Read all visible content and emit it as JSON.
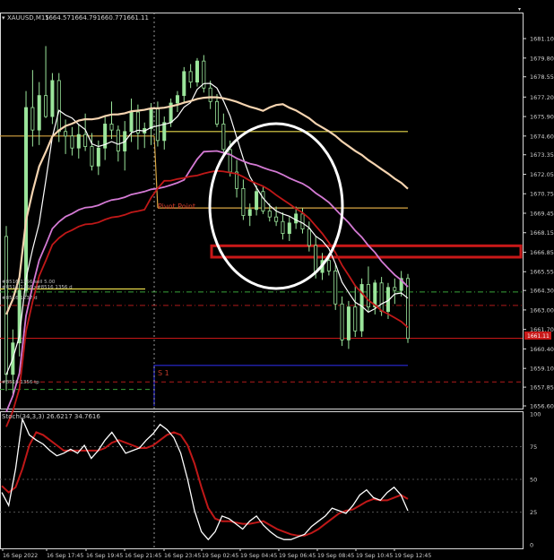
{
  "window": {
    "symbol_label": "XAUUSD,M15",
    "ohlc": [
      "1664.57",
      "1664.79",
      "1660.77",
      "1661.11"
    ]
  },
  "colors": {
    "background": "#000000",
    "bull_candle": "#9be59b",
    "bear_candle": "#9be59b",
    "white_line": "#ffffff",
    "peach_ma": "#f5d4b0",
    "violet_ma": "#d47ad4",
    "red_ma": "#c01818",
    "pivot_line": "#d9a642",
    "yellow_line": "#e6d84a",
    "red_zone": "#c81818",
    "ellipse": "#ffffff",
    "s1_line": "#2a2ad8",
    "stoch_main": "#ffffff",
    "stoch_signal": "#c01818"
  },
  "annotations": {
    "pivot_label": "Pivot Point",
    "s1_label": "S 1",
    "order_labels": [
      "#8516 1356 sell 5.00",
      "#8516 1356 s#8516 1356 d",
      "#8516 1237 d",
      "#8516 1356 tp"
    ],
    "current_price": "1661.11"
  },
  "stoch": {
    "label": "Stoch(34,3,3) 26.6217 34.7616",
    "levels": [
      "100",
      "75",
      "50",
      "25",
      "0"
    ]
  },
  "chart_data": [
    {
      "type": "candlestick",
      "title": "XAUUSD,M15",
      "ylim": [
        1656.6,
        1682.0
      ],
      "yticks": [
        "1681.10",
        "1679.80",
        "1678.55",
        "1677.20",
        "1675.90",
        "1674.60",
        "1673.35",
        "1672.05",
        "1670.75",
        "1669.45",
        "1668.15",
        "1666.85",
        "1665.55",
        "1664.30",
        "1663.00",
        "1661.70",
        "1660.40",
        "1659.10",
        "1657.85",
        "1656.60"
      ],
      "xticks": [
        "16 Sep 2022",
        "16 Sep 17:45",
        "16 Sep 19:45",
        "16 Sep 21:45",
        "16 Sep 23:45",
        "19 Sep 02:45",
        "19 Sep 04:45",
        "19 Sep 06:45",
        "19 Sep 08:45",
        "19 Sep 10:45",
        "19 Sep 12:45"
      ],
      "candles": [
        {
          "o": 1667.9,
          "h": 1668.6,
          "l": 1657.6,
          "c": 1658.7
        },
        {
          "o": 1658.7,
          "h": 1661.7,
          "l": 1657.4,
          "c": 1660.8
        },
        {
          "o": 1660.8,
          "h": 1665.2,
          "l": 1659.9,
          "c": 1664.3
        },
        {
          "o": 1664.3,
          "h": 1677.6,
          "l": 1663.9,
          "c": 1676.5
        },
        {
          "o": 1676.5,
          "h": 1679.0,
          "l": 1673.9,
          "c": 1675.0
        },
        {
          "o": 1675.0,
          "h": 1678.2,
          "l": 1674.0,
          "c": 1677.3
        },
        {
          "o": 1677.3,
          "h": 1680.6,
          "l": 1675.8,
          "c": 1675.9
        },
        {
          "o": 1675.9,
          "h": 1678.8,
          "l": 1675.4,
          "c": 1678.3
        },
        {
          "o": 1678.3,
          "h": 1678.8,
          "l": 1674.2,
          "c": 1674.9
        },
        {
          "o": 1674.9,
          "h": 1675.7,
          "l": 1673.4,
          "c": 1674.6
        },
        {
          "o": 1674.6,
          "h": 1675.2,
          "l": 1673.3,
          "c": 1673.8
        },
        {
          "o": 1673.8,
          "h": 1675.4,
          "l": 1673.1,
          "c": 1674.7
        },
        {
          "o": 1674.7,
          "h": 1676.1,
          "l": 1673.6,
          "c": 1673.9
        },
        {
          "o": 1673.9,
          "h": 1674.8,
          "l": 1672.3,
          "c": 1672.6
        },
        {
          "o": 1672.6,
          "h": 1674.3,
          "l": 1672.0,
          "c": 1673.8
        },
        {
          "o": 1673.8,
          "h": 1676.0,
          "l": 1673.0,
          "c": 1675.4
        },
        {
          "o": 1675.4,
          "h": 1676.9,
          "l": 1674.4,
          "c": 1675.0
        },
        {
          "o": 1675.0,
          "h": 1675.3,
          "l": 1672.9,
          "c": 1673.6
        },
        {
          "o": 1673.6,
          "h": 1675.6,
          "l": 1672.3,
          "c": 1674.9
        },
        {
          "o": 1674.9,
          "h": 1677.1,
          "l": 1674.2,
          "c": 1676.2
        },
        {
          "o": 1676.2,
          "h": 1676.7,
          "l": 1673.7,
          "c": 1674.8
        },
        {
          "o": 1674.8,
          "h": 1675.5,
          "l": 1673.8,
          "c": 1675.1
        },
        {
          "o": 1675.1,
          "h": 1676.8,
          "l": 1674.0,
          "c": 1676.4
        },
        {
          "o": 1676.4,
          "h": 1676.9,
          "l": 1673.9,
          "c": 1674.3
        },
        {
          "o": 1674.3,
          "h": 1675.9,
          "l": 1673.7,
          "c": 1675.5
        },
        {
          "o": 1675.5,
          "h": 1677.1,
          "l": 1675.2,
          "c": 1676.8
        },
        {
          "o": 1676.8,
          "h": 1677.6,
          "l": 1676.2,
          "c": 1677.3
        },
        {
          "o": 1677.3,
          "h": 1679.2,
          "l": 1676.8,
          "c": 1678.9
        },
        {
          "o": 1678.9,
          "h": 1679.4,
          "l": 1677.8,
          "c": 1678.2
        },
        {
          "o": 1678.2,
          "h": 1679.8,
          "l": 1677.9,
          "c": 1679.6
        },
        {
          "o": 1679.6,
          "h": 1680.0,
          "l": 1677.5,
          "c": 1677.8
        },
        {
          "o": 1677.8,
          "h": 1678.3,
          "l": 1676.4,
          "c": 1676.9
        },
        {
          "o": 1676.9,
          "h": 1677.4,
          "l": 1675.2,
          "c": 1675.4
        },
        {
          "o": 1675.4,
          "h": 1676.1,
          "l": 1673.4,
          "c": 1673.7
        },
        {
          "o": 1673.7,
          "h": 1674.3,
          "l": 1671.9,
          "c": 1672.2
        },
        {
          "o": 1672.2,
          "h": 1673.0,
          "l": 1670.5,
          "c": 1671.1
        },
        {
          "o": 1671.1,
          "h": 1671.7,
          "l": 1669.0,
          "c": 1669.3
        },
        {
          "o": 1669.3,
          "h": 1670.1,
          "l": 1668.6,
          "c": 1669.7
        },
        {
          "o": 1669.7,
          "h": 1671.3,
          "l": 1669.3,
          "c": 1670.9
        },
        {
          "o": 1670.9,
          "h": 1671.2,
          "l": 1669.4,
          "c": 1669.6
        },
        {
          "o": 1669.6,
          "h": 1670.1,
          "l": 1668.9,
          "c": 1669.2
        },
        {
          "o": 1669.2,
          "h": 1669.9,
          "l": 1668.6,
          "c": 1668.9
        },
        {
          "o": 1668.9,
          "h": 1669.5,
          "l": 1667.7,
          "c": 1668.1
        },
        {
          "o": 1668.1,
          "h": 1669.2,
          "l": 1667.6,
          "c": 1668.8
        },
        {
          "o": 1668.8,
          "h": 1669.9,
          "l": 1668.4,
          "c": 1669.4
        },
        {
          "o": 1669.4,
          "h": 1669.8,
          "l": 1668.1,
          "c": 1668.4
        },
        {
          "o": 1668.4,
          "h": 1668.9,
          "l": 1666.9,
          "c": 1667.3
        },
        {
          "o": 1667.3,
          "h": 1667.9,
          "l": 1665.1,
          "c": 1665.5
        },
        {
          "o": 1665.5,
          "h": 1666.8,
          "l": 1665.0,
          "c": 1666.3
        },
        {
          "o": 1666.3,
          "h": 1666.7,
          "l": 1665.3,
          "c": 1665.6
        },
        {
          "o": 1665.6,
          "h": 1666.1,
          "l": 1663.0,
          "c": 1663.4
        },
        {
          "o": 1663.4,
          "h": 1663.9,
          "l": 1660.6,
          "c": 1661.0
        },
        {
          "o": 1661.0,
          "h": 1663.6,
          "l": 1660.4,
          "c": 1663.2
        },
        {
          "o": 1663.2,
          "h": 1664.6,
          "l": 1661.2,
          "c": 1661.6
        },
        {
          "o": 1661.6,
          "h": 1665.1,
          "l": 1661.2,
          "c": 1664.7
        },
        {
          "o": 1664.7,
          "h": 1665.9,
          "l": 1662.9,
          "c": 1663.2
        },
        {
          "o": 1663.2,
          "h": 1665.0,
          "l": 1662.7,
          "c": 1664.8
        },
        {
          "o": 1664.8,
          "h": 1665.2,
          "l": 1662.6,
          "c": 1662.9
        },
        {
          "o": 1662.9,
          "h": 1664.8,
          "l": 1662.4,
          "c": 1664.5
        },
        {
          "o": 1664.5,
          "h": 1665.1,
          "l": 1663.4,
          "c": 1664.3
        },
        {
          "o": 1664.3,
          "h": 1665.6,
          "l": 1663.9,
          "c": 1665.1
        },
        {
          "o": 1665.1,
          "h": 1665.4,
          "l": 1660.8,
          "c": 1661.1
        }
      ],
      "overlays": {
        "horizontal_levels": [
          {
            "name": "yellow-level-1",
            "value": 1674.9
          },
          {
            "name": "pivot-level",
            "value": 1669.8
          },
          {
            "name": "yellow-level-2",
            "value": 1664.4
          },
          {
            "name": "red-dashdot-level",
            "value": 1663.3
          },
          {
            "name": "current-price-level",
            "value": 1661.11
          },
          {
            "name": "s1-level",
            "value": 1659.3
          },
          {
            "name": "red-dashed-low",
            "value": 1658.2
          }
        ],
        "red_zone": [
          1666.7,
          1667.1
        ]
      }
    },
    {
      "type": "line",
      "title": "Stoch(34,3,3) 26.6217 34.7616",
      "ylim": [
        0,
        100
      ],
      "levels": [
        75,
        50,
        25
      ],
      "series": [
        {
          "values": [
            40,
            30,
            58,
            96,
            84,
            80,
            77,
            72,
            68,
            70,
            73,
            70,
            76,
            66,
            72,
            80,
            86,
            78,
            70,
            72,
            74,
            80,
            85,
            92,
            88,
            82,
            70,
            50,
            26,
            10,
            4,
            10,
            22,
            20,
            16,
            12,
            18,
            22,
            15,
            10,
            6,
            4,
            4,
            6,
            8,
            14,
            18,
            22,
            28,
            26,
            24,
            30,
            38,
            42,
            36,
            34,
            40,
            44,
            38,
            26
          ]
        },
        {
          "values": [
            45,
            40,
            44,
            58,
            76,
            86,
            84,
            80,
            76,
            72,
            72,
            72,
            72,
            72,
            72,
            74,
            78,
            80,
            78,
            76,
            74,
            74,
            76,
            80,
            84,
            86,
            84,
            76,
            62,
            44,
            28,
            20,
            18,
            18,
            17,
            16,
            16,
            17,
            18,
            15,
            12,
            10,
            8,
            7,
            7,
            9,
            12,
            16,
            20,
            24,
            26,
            27,
            30,
            33,
            35,
            34,
            34,
            36,
            38,
            35
          ]
        }
      ]
    }
  ]
}
